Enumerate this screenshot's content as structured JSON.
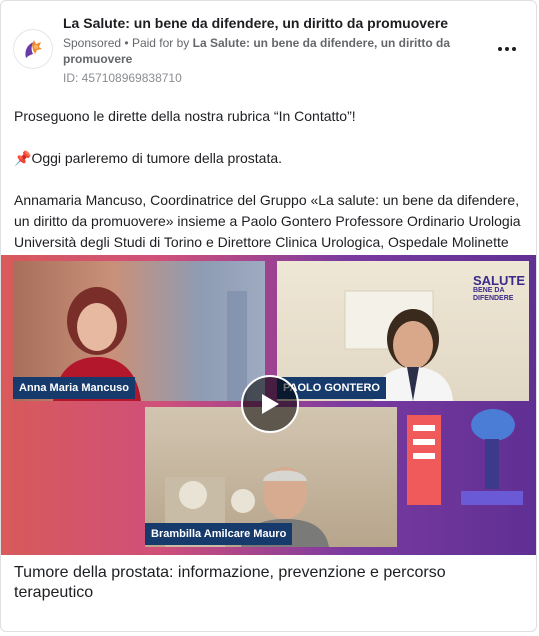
{
  "header": {
    "page_name": "La Salute: un bene da difendere, un diritto da promuovere",
    "sponsored_label": "Sponsored",
    "separator": "•",
    "paid_for_prefix": "Paid for by",
    "paid_for_name": "La Salute: un bene da difendere, un diritto da promuovere",
    "ad_id": "ID: 457108969838710",
    "more_icon": "more-horizontal-icon"
  },
  "post": {
    "line1": "Proseguono le dirette della nostra rubrica “In Contatto”!",
    "line2_icon": "📌",
    "line2": "Oggi parleremo di tumore della prostata.",
    "line3": "Annamaria Mancuso, Coordinatrice del Gruppo «La salute: un bene da difendere, un diritto da promuovere» insieme a Paolo Gontero Professore Ordinario Urologia Università degli Studi di Torino e Direttore Clinica Urologica, Ospedale Molinette -…"
  },
  "video": {
    "speaker_1": "Anna Maria Mancuso",
    "speaker_2": "PAOLO GONTERO",
    "speaker_3": "Brambilla Amilcare Mauro",
    "logo_main": "SALUTE",
    "logo_sub": "BENE DA DIFENDERE",
    "play_icon": "play-icon"
  },
  "caption": "Tumore della prostata: informazione, prevenzione e percorso terapeutico",
  "colors": {
    "brand_orange": "#f28c28",
    "brand_purple": "#5f2f93",
    "name_tag_bg": "#163a6b"
  }
}
